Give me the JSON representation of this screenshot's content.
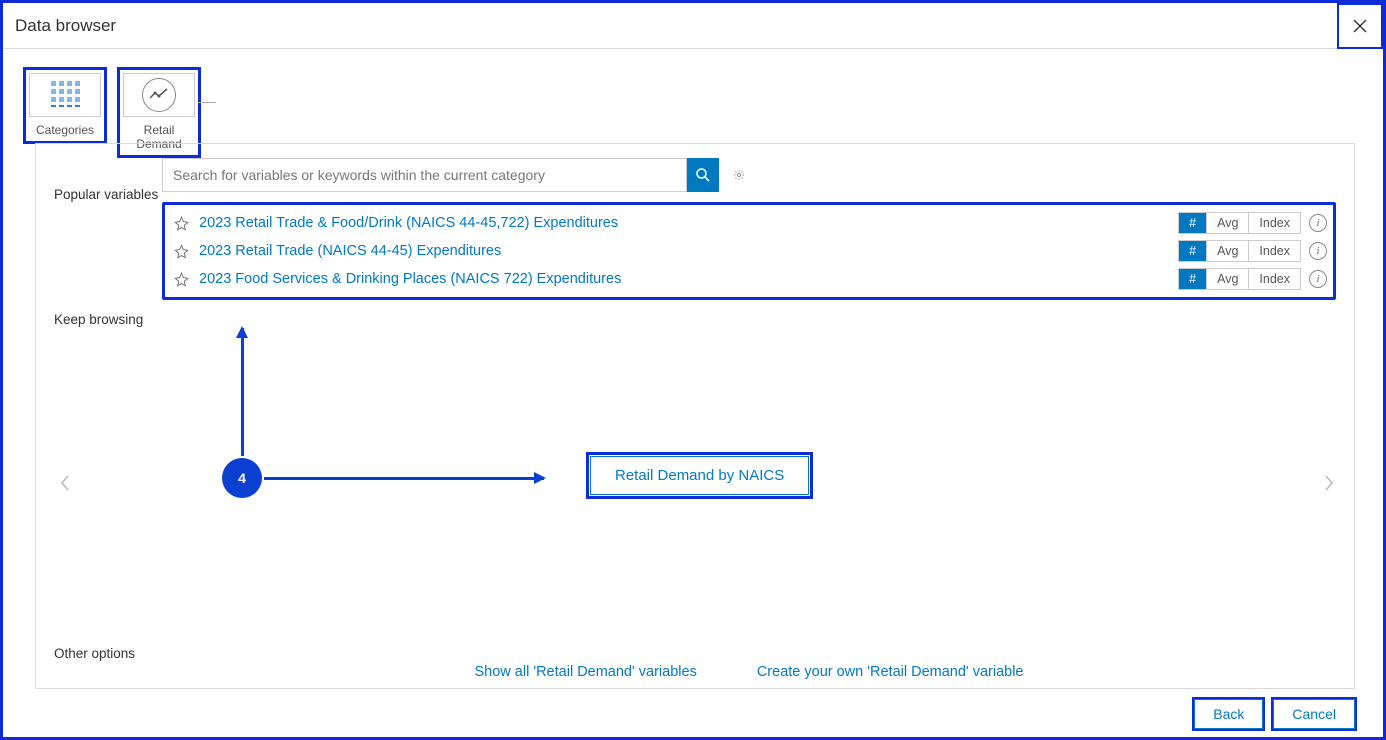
{
  "window": {
    "title": "Data browser"
  },
  "crumbs": {
    "categories_label": "Categories",
    "retail_label": "Retail Demand"
  },
  "search": {
    "placeholder": "Search for variables or keywords within the current category"
  },
  "section_labels": {
    "popular": "Popular variables",
    "keep_browsing": "Keep browsing",
    "other": "Other options"
  },
  "variables": [
    {
      "label": "2023 Retail Trade & Food/Drink (NAICS 44-45,722) Expenditures"
    },
    {
      "label": "2023 Retail Trade (NAICS 44-45) Expenditures"
    },
    {
      "label": "2023 Food Services & Drinking Places (NAICS 722) Expenditures"
    }
  ],
  "pills": {
    "hash": "#",
    "avg": "Avg",
    "index": "Index"
  },
  "kb_card": "Retail Demand by NAICS",
  "annotation": {
    "num": "4"
  },
  "other_links": {
    "show_all": "Show all 'Retail Demand' variables",
    "create": "Create your own 'Retail Demand' variable"
  },
  "footer": {
    "back": "Back",
    "cancel": "Cancel"
  }
}
